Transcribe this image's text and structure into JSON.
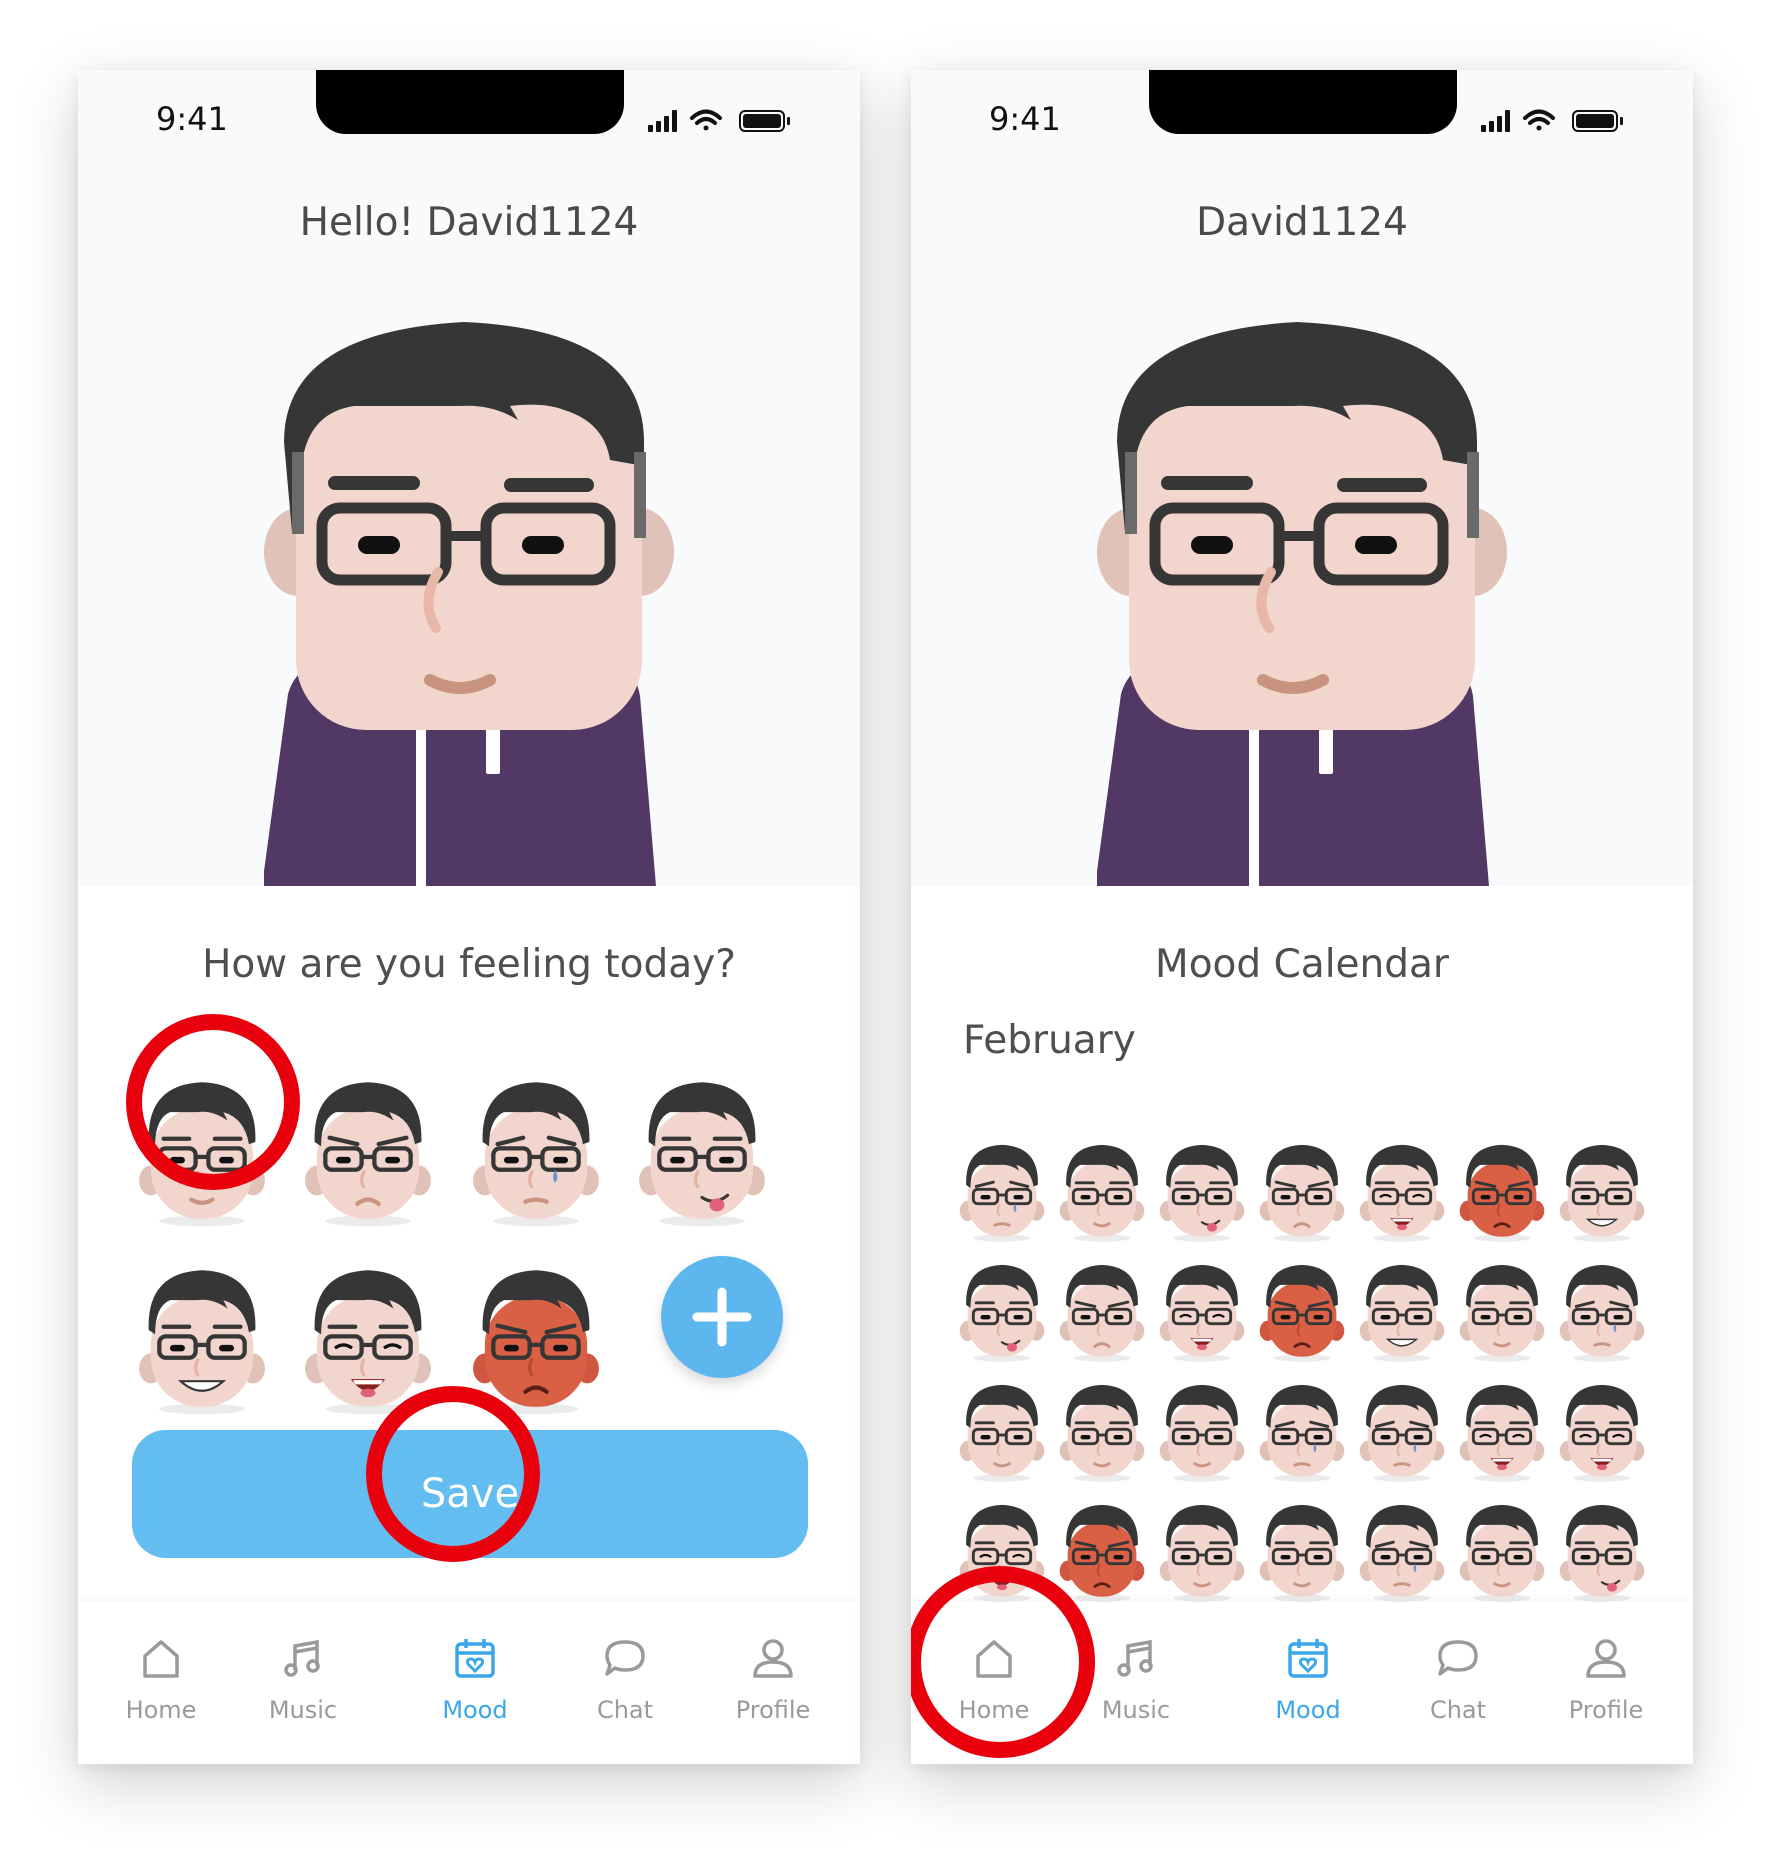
{
  "status_bar": {
    "time": "9:41"
  },
  "left_screen": {
    "title": "Hello! David1124",
    "prompt": "How are you feeling today?",
    "mood_options": [
      {
        "name": "calm",
        "face": "calm",
        "selected": true
      },
      {
        "name": "annoyed",
        "face": "annoyed"
      },
      {
        "name": "sad",
        "face": "sad"
      },
      {
        "name": "playful",
        "face": "tongue"
      },
      {
        "name": "happy",
        "face": "smile"
      },
      {
        "name": "laughing",
        "face": "laugh"
      },
      {
        "name": "angry",
        "face": "angry"
      }
    ],
    "add_icon": "plus-icon",
    "save_label": "Save"
  },
  "right_screen": {
    "title": "David1124",
    "calendar_title": "Mood Calendar",
    "month": "February",
    "days": [
      "sad",
      "calm",
      "tongue",
      "annoyed",
      "laugh",
      "angry",
      "smile",
      "tongue",
      "annoyed",
      "laugh",
      "angry",
      "smile",
      "calm",
      "sad",
      "calm",
      "calm",
      "calm",
      "sad",
      "sad",
      "laugh",
      "laugh",
      "laugh",
      "angry",
      "calm",
      "calm",
      "sad",
      "calm",
      "tongue"
    ]
  },
  "tabs": [
    {
      "label": "Home",
      "icon": "home-icon"
    },
    {
      "label": "Music",
      "icon": "music-icon"
    },
    {
      "label": "Mood",
      "icon": "calendar-heart-icon",
      "active": true
    },
    {
      "label": "Chat",
      "icon": "chat-icon"
    },
    {
      "label": "Profile",
      "icon": "profile-icon"
    }
  ],
  "colors": {
    "accent": "#5db7ee",
    "save_button": "#63bdf0",
    "annotation": "#e8000d",
    "hoodie": "#523865",
    "skin": "#f2d5cc",
    "angry_skin": "#d95f45"
  }
}
